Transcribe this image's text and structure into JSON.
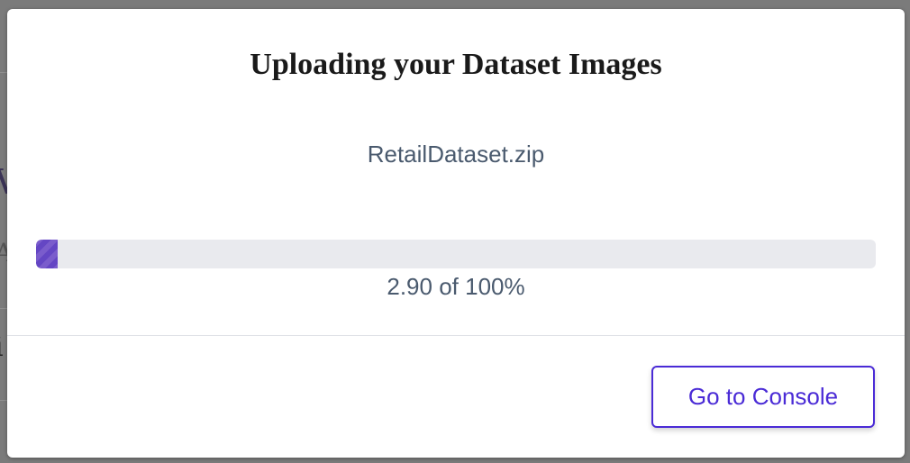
{
  "modal": {
    "title": "Uploading your Dataset Images",
    "file_name": "RetailDataset.zip",
    "progress": {
      "percent": 2.9,
      "label": "2.90 of 100%"
    },
    "button_label": "Go to Console"
  },
  "background": {
    "chars": [
      "V",
      "A",
      "i"
    ]
  },
  "colors": {
    "accent": "#4a2bd6",
    "progress_fill": "#7152c8",
    "progress_track": "#e9eaee",
    "overlay": "#7b7b7b",
    "muted_text": "#4a5a6e"
  }
}
